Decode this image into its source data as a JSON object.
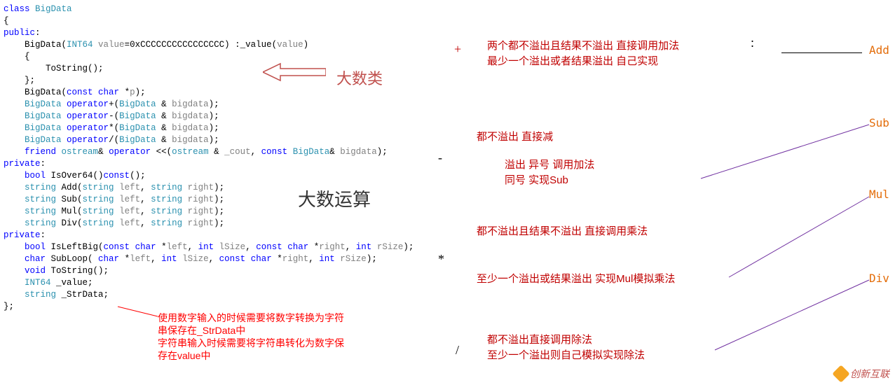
{
  "code": {
    "lines": [
      [
        {
          "cls": "kw",
          "t": "class"
        },
        {
          "cls": "punct",
          "t": " "
        },
        {
          "cls": "type",
          "t": "BigData"
        }
      ],
      [
        {
          "cls": "punct",
          "t": "{"
        }
      ],
      [
        {
          "cls": "kw",
          "t": "public"
        },
        {
          "cls": "punct",
          "t": ":"
        }
      ],
      [
        {
          "cls": "punct",
          "t": "    BigData("
        },
        {
          "cls": "type",
          "t": "INT64"
        },
        {
          "cls": "punct",
          "t": " "
        },
        {
          "cls": "param",
          "t": "value"
        },
        {
          "cls": "punct",
          "t": "=0xCCCCCCCCCCCCCCCC) :_value("
        },
        {
          "cls": "param",
          "t": "value"
        },
        {
          "cls": "punct",
          "t": ")"
        }
      ],
      [
        {
          "cls": "punct",
          "t": "    {"
        }
      ],
      [
        {
          "cls": "punct",
          "t": "        ToString();"
        }
      ],
      [
        {
          "cls": "punct",
          "t": "    };"
        }
      ],
      [
        {
          "cls": "punct",
          "t": "    BigData("
        },
        {
          "cls": "kw",
          "t": "const"
        },
        {
          "cls": "punct",
          "t": " "
        },
        {
          "cls": "kw",
          "t": "char"
        },
        {
          "cls": "punct",
          "t": " *"
        },
        {
          "cls": "param",
          "t": "p"
        },
        {
          "cls": "punct",
          "t": ");"
        }
      ],
      [
        {
          "cls": "punct",
          "t": "    "
        },
        {
          "cls": "type",
          "t": "BigData"
        },
        {
          "cls": "punct",
          "t": " "
        },
        {
          "cls": "kw",
          "t": "operator"
        },
        {
          "cls": "punct",
          "t": "+("
        },
        {
          "cls": "type",
          "t": "BigData"
        },
        {
          "cls": "punct",
          "t": " & "
        },
        {
          "cls": "param",
          "t": "bigdata"
        },
        {
          "cls": "punct",
          "t": ");"
        }
      ],
      [
        {
          "cls": "punct",
          "t": "    "
        },
        {
          "cls": "type",
          "t": "BigData"
        },
        {
          "cls": "punct",
          "t": " "
        },
        {
          "cls": "kw",
          "t": "operator"
        },
        {
          "cls": "punct",
          "t": "-("
        },
        {
          "cls": "type",
          "t": "BigData"
        },
        {
          "cls": "punct",
          "t": " & "
        },
        {
          "cls": "param",
          "t": "bigdata"
        },
        {
          "cls": "punct",
          "t": ");"
        }
      ],
      [
        {
          "cls": "punct",
          "t": "    "
        },
        {
          "cls": "type",
          "t": "BigData"
        },
        {
          "cls": "punct",
          "t": " "
        },
        {
          "cls": "kw",
          "t": "operator"
        },
        {
          "cls": "punct",
          "t": "*("
        },
        {
          "cls": "type",
          "t": "BigData"
        },
        {
          "cls": "punct",
          "t": " & "
        },
        {
          "cls": "param",
          "t": "bigdata"
        },
        {
          "cls": "punct",
          "t": ");"
        }
      ],
      [
        {
          "cls": "punct",
          "t": "    "
        },
        {
          "cls": "type",
          "t": "BigData"
        },
        {
          "cls": "punct",
          "t": " "
        },
        {
          "cls": "kw",
          "t": "operator"
        },
        {
          "cls": "punct",
          "t": "/("
        },
        {
          "cls": "type",
          "t": "BigData"
        },
        {
          "cls": "punct",
          "t": " & "
        },
        {
          "cls": "param",
          "t": "bigdata"
        },
        {
          "cls": "punct",
          "t": ");"
        }
      ],
      [
        {
          "cls": "punct",
          "t": ""
        }
      ],
      [
        {
          "cls": "punct",
          "t": "    "
        },
        {
          "cls": "kw",
          "t": "friend"
        },
        {
          "cls": "punct",
          "t": " "
        },
        {
          "cls": "type",
          "t": "ostream"
        },
        {
          "cls": "punct",
          "t": "& "
        },
        {
          "cls": "kw",
          "t": "operator"
        },
        {
          "cls": "punct",
          "t": " <<("
        },
        {
          "cls": "type",
          "t": "ostream"
        },
        {
          "cls": "punct",
          "t": " & "
        },
        {
          "cls": "param",
          "t": "_cout"
        },
        {
          "cls": "punct",
          "t": ", "
        },
        {
          "cls": "kw",
          "t": "const"
        },
        {
          "cls": "punct",
          "t": " "
        },
        {
          "cls": "type",
          "t": "BigData"
        },
        {
          "cls": "punct",
          "t": "& "
        },
        {
          "cls": "param",
          "t": "bigdata"
        },
        {
          "cls": "punct",
          "t": ");"
        }
      ],
      [
        {
          "cls": "kw",
          "t": "private"
        },
        {
          "cls": "punct",
          "t": ":"
        }
      ],
      [
        {
          "cls": "punct",
          "t": "    "
        },
        {
          "cls": "kw",
          "t": "bool"
        },
        {
          "cls": "punct",
          "t": " IsOver64()"
        },
        {
          "cls": "kw",
          "t": "const"
        },
        {
          "cls": "punct",
          "t": "();"
        }
      ],
      [
        {
          "cls": "punct",
          "t": "    "
        },
        {
          "cls": "type",
          "t": "string"
        },
        {
          "cls": "punct",
          "t": " Add("
        },
        {
          "cls": "type",
          "t": "string"
        },
        {
          "cls": "punct",
          "t": " "
        },
        {
          "cls": "param",
          "t": "left"
        },
        {
          "cls": "punct",
          "t": ", "
        },
        {
          "cls": "type",
          "t": "string"
        },
        {
          "cls": "punct",
          "t": " "
        },
        {
          "cls": "param",
          "t": "right"
        },
        {
          "cls": "punct",
          "t": ");"
        }
      ],
      [
        {
          "cls": "punct",
          "t": "    "
        },
        {
          "cls": "type",
          "t": "string"
        },
        {
          "cls": "punct",
          "t": " Sub("
        },
        {
          "cls": "type",
          "t": "string"
        },
        {
          "cls": "punct",
          "t": " "
        },
        {
          "cls": "param",
          "t": "left"
        },
        {
          "cls": "punct",
          "t": ", "
        },
        {
          "cls": "type",
          "t": "string"
        },
        {
          "cls": "punct",
          "t": " "
        },
        {
          "cls": "param",
          "t": "right"
        },
        {
          "cls": "punct",
          "t": ");"
        }
      ],
      [
        {
          "cls": "punct",
          "t": "    "
        },
        {
          "cls": "type",
          "t": "string"
        },
        {
          "cls": "punct",
          "t": " Mul("
        },
        {
          "cls": "type",
          "t": "string"
        },
        {
          "cls": "punct",
          "t": " "
        },
        {
          "cls": "param",
          "t": "left"
        },
        {
          "cls": "punct",
          "t": ", "
        },
        {
          "cls": "type",
          "t": "string"
        },
        {
          "cls": "punct",
          "t": " "
        },
        {
          "cls": "param",
          "t": "right"
        },
        {
          "cls": "punct",
          "t": ");"
        }
      ],
      [
        {
          "cls": "punct",
          "t": "    "
        },
        {
          "cls": "type",
          "t": "string"
        },
        {
          "cls": "punct",
          "t": " Div("
        },
        {
          "cls": "type",
          "t": "string"
        },
        {
          "cls": "punct",
          "t": " "
        },
        {
          "cls": "param",
          "t": "left"
        },
        {
          "cls": "punct",
          "t": ", "
        },
        {
          "cls": "type",
          "t": "string"
        },
        {
          "cls": "punct",
          "t": " "
        },
        {
          "cls": "param",
          "t": "right"
        },
        {
          "cls": "punct",
          "t": ");"
        }
      ],
      [
        {
          "cls": "punct",
          "t": ""
        }
      ],
      [
        {
          "cls": "punct",
          "t": ""
        }
      ],
      [
        {
          "cls": "kw",
          "t": "private"
        },
        {
          "cls": "punct",
          "t": ":"
        }
      ],
      [
        {
          "cls": "punct",
          "t": "    "
        },
        {
          "cls": "kw",
          "t": "bool"
        },
        {
          "cls": "punct",
          "t": " IsLeftBig("
        },
        {
          "cls": "kw",
          "t": "const"
        },
        {
          "cls": "punct",
          "t": " "
        },
        {
          "cls": "kw",
          "t": "char"
        },
        {
          "cls": "punct",
          "t": " *"
        },
        {
          "cls": "param",
          "t": "left"
        },
        {
          "cls": "punct",
          "t": ", "
        },
        {
          "cls": "kw",
          "t": "int"
        },
        {
          "cls": "punct",
          "t": " "
        },
        {
          "cls": "param",
          "t": "lSize"
        },
        {
          "cls": "punct",
          "t": ", "
        },
        {
          "cls": "kw",
          "t": "const"
        },
        {
          "cls": "punct",
          "t": " "
        },
        {
          "cls": "kw",
          "t": "char"
        },
        {
          "cls": "punct",
          "t": " *"
        },
        {
          "cls": "param",
          "t": "right"
        },
        {
          "cls": "punct",
          "t": ", "
        },
        {
          "cls": "kw",
          "t": "int"
        },
        {
          "cls": "punct",
          "t": " "
        },
        {
          "cls": "param",
          "t": "rSize"
        },
        {
          "cls": "punct",
          "t": ");"
        }
      ],
      [
        {
          "cls": "punct",
          "t": "    "
        },
        {
          "cls": "kw",
          "t": "char"
        },
        {
          "cls": "punct",
          "t": " SubLoop( "
        },
        {
          "cls": "kw",
          "t": "char"
        },
        {
          "cls": "punct",
          "t": " *"
        },
        {
          "cls": "param",
          "t": "left"
        },
        {
          "cls": "punct",
          "t": ", "
        },
        {
          "cls": "kw",
          "t": "int"
        },
        {
          "cls": "punct",
          "t": " "
        },
        {
          "cls": "param",
          "t": "lSize"
        },
        {
          "cls": "punct",
          "t": ", "
        },
        {
          "cls": "kw",
          "t": "const"
        },
        {
          "cls": "punct",
          "t": " "
        },
        {
          "cls": "kw",
          "t": "char"
        },
        {
          "cls": "punct",
          "t": " *"
        },
        {
          "cls": "param",
          "t": "right"
        },
        {
          "cls": "punct",
          "t": ", "
        },
        {
          "cls": "kw",
          "t": "int"
        },
        {
          "cls": "punct",
          "t": " "
        },
        {
          "cls": "param",
          "t": "rSize"
        },
        {
          "cls": "punct",
          "t": ");"
        }
      ],
      [
        {
          "cls": "punct",
          "t": "    "
        },
        {
          "cls": "kw",
          "t": "void"
        },
        {
          "cls": "punct",
          "t": " ToString();"
        }
      ],
      [
        {
          "cls": "punct",
          "t": "    "
        },
        {
          "cls": "type",
          "t": "INT64"
        },
        {
          "cls": "punct",
          "t": " _value;"
        }
      ],
      [
        {
          "cls": "punct",
          "t": "    "
        },
        {
          "cls": "type",
          "t": "string"
        },
        {
          "cls": "punct",
          "t": " _StrData;"
        }
      ],
      [
        {
          "cls": "punct",
          "t": "};"
        }
      ]
    ]
  },
  "labels": {
    "class_label": "大数类",
    "calc_label": "大数运算",
    "tostring_note_1": "使用数字输入的时候需要将数字转换为字符",
    "tostring_note_2": "串保存在_StrData中",
    "tostring_note_3": "字符串输入时候需要将字符串转化为数字保",
    "tostring_note_4": "存在value中"
  },
  "ops": {
    "plus": {
      "sym": "+",
      "line1": "两个都不溢出且结果不溢出    直接调用加法",
      "line2": "最少一个溢出或者结果溢出    自己实现",
      "name": "Add",
      "colon": "："
    },
    "minus": {
      "sym": "-",
      "line1": "都不溢出    直接减",
      "line2": "溢出    异号  调用加法",
      "line3": "        同号  实现Sub",
      "name": "Sub"
    },
    "mul": {
      "sym": "*",
      "line1": "都不溢出且结果不溢出  直接调用乘法",
      "line2": "至少一个溢出或结果溢出  实现Mul模拟乘法",
      "name": "Mul"
    },
    "div": {
      "sym": "/",
      "line1": "都不溢出直接调用除法",
      "line2": "至少一个溢出则自己模拟实现除法",
      "name": "Div"
    }
  },
  "watermark": "创新互联"
}
